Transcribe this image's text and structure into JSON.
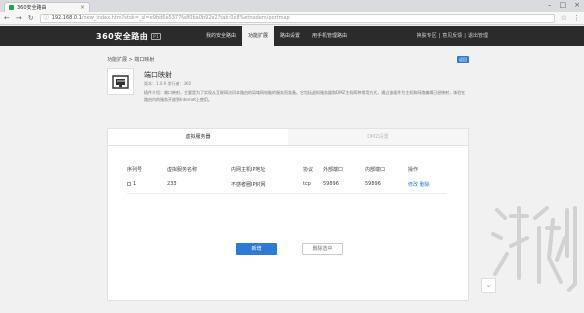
{
  "browser": {
    "tab_title": "360安全路由",
    "url_host": "192.168.0.1",
    "url_path": "/new_index.htm?stok=_sl=e9bd6e5377fa80ba0b92e2?tab:0x8%etnodem/portmap",
    "window_controls": [
      "–",
      "□",
      "×"
    ]
  },
  "header": {
    "logo": "360安全路由",
    "logo_badge": "P1",
    "nav": [
      "我的安全路由",
      "功能扩展",
      "路由设置",
      "用手机管理路由"
    ],
    "active_nav_index": 1,
    "right_links": [
      "换肤专区",
      "意见反馈",
      "退出管理"
    ]
  },
  "breadcrumb": "功能扩展 > 端口映射",
  "back_button": "返回",
  "app": {
    "name": "端口映射",
    "meta": "版本：1.0.9    发行者：360",
    "description": "插件介绍：端口映射，主要是为了实现从互联网访问本路由的局域网电脑的服务而准备。它包括虚拟服务器和DMZ主机两种常用方式，通过该插件为主机和网络编辑已经映射，体验在路由内的服务开放到Internet上使用。"
  },
  "panel": {
    "tabs": [
      "虚拟服务器",
      "DMZ设置"
    ],
    "active_tab_index": 0,
    "columns": [
      "序列号",
      "虚拟服务名称",
      "内网主机IP地址",
      "协议",
      "外部端口",
      "内部端口",
      "操作"
    ],
    "rows": [
      {
        "index": "1",
        "name": "233",
        "host": "不感者圈IP封网",
        "protocol": "tcp",
        "ext_port": "59896",
        "int_port": "59896",
        "edit": "修改",
        "delete": "删除"
      }
    ],
    "add_button": "新增",
    "delete_selected_button": "删除选中"
  },
  "scroll_top_icon": "chevron-up-icon",
  "colors": {
    "header_bg": "#2b2b2b",
    "accent": "#2f7ad5"
  }
}
